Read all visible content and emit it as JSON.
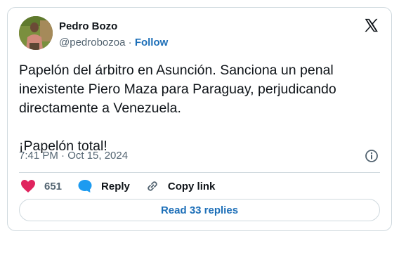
{
  "author": {
    "name": "Pedro Bozo",
    "handle": "@pedrobozoa",
    "separator": "·",
    "follow_label": "Follow"
  },
  "post": {
    "text": "Papelón del árbitro en Asunción. Sanciona un penal inexistente Piero Maza para Paraguay, perjudicando directamente a Venezuela.\n\n¡Papelón total!",
    "timestamp": "7:41 PM · Oct 15, 2024"
  },
  "actions": {
    "like_count": "651",
    "reply_label": "Reply",
    "copy_label": "Copy link"
  },
  "replies_button": "Read 33 replies",
  "icons": {
    "brand": "x-logo-icon",
    "info": "info-icon",
    "like": "heart-icon",
    "reply": "speech-bubble-icon",
    "copy": "link-icon"
  },
  "colors": {
    "like": "#e0245e",
    "reply": "#1d9bf0",
    "link_blue": "#1d6fb8",
    "text_secondary": "#536471",
    "border": "#cfd9de"
  }
}
